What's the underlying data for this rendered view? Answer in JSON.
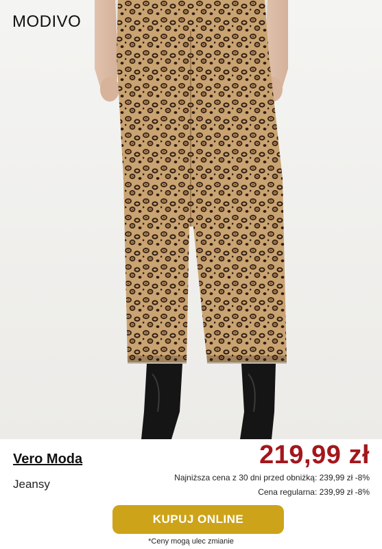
{
  "header": {
    "logo": "MODIVO"
  },
  "product": {
    "brand": "Vero Moda",
    "category": "Jeansy",
    "price": "219,99 zł",
    "lowest_price_note": "Najniższa cena z 30 dni przed obniżką: 239,99 zł -8%",
    "regular_price_note": "Cena regularna: 239,99 zł -8%"
  },
  "cta": {
    "buy_label": "KUPUJ ONLINE"
  },
  "footer": {
    "disclaimer": "*Ceny mogą ulec zmianie"
  },
  "colors": {
    "price": "#a3171c",
    "button": "#cda419",
    "background": "#ffffff"
  }
}
